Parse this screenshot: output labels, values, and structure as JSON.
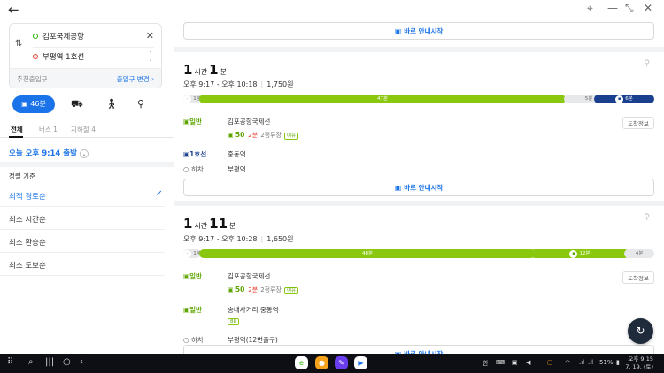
{
  "origin": "김포국제공항",
  "destination": "부평역 1호선",
  "entrance_recommend": "추천출입구",
  "entrance_change": "출입구 변경",
  "modes": {
    "transit_time": "46분"
  },
  "tabs": [
    "전체",
    "버스 1",
    "지하철 4"
  ],
  "departure": "오늘 오후 9:14 출발",
  "sort": {
    "title": "정렬 기준",
    "options": [
      "최적 경로순",
      "최소 시간순",
      "최소 환승순",
      "최소 도보순"
    ],
    "selected": 0
  },
  "nav_label": "바로 안내시작",
  "routes": [
    {
      "dur_h": "1",
      "dur_h_unit": "시간",
      "dur_m": "1",
      "dur_m_unit": "분",
      "time_range": "오후 9:17 - 오후 10:18",
      "fare": "1,750원",
      "segments": [
        {
          "type": "grey",
          "label": "1분"
        },
        {
          "type": "green",
          "label": "47분",
          "fraction": 0.77
        },
        {
          "type": "grey",
          "label": "5분"
        },
        {
          "type": "navy",
          "label": "6분"
        }
      ],
      "legs": [
        {
          "mode": "일반",
          "kind": "bus",
          "stop": "김포공항국제선",
          "badge": "도착정보",
          "bus_no": "50",
          "wait": "2분",
          "stops_left": "2정류장",
          "tag": "여유"
        },
        {
          "mode": "1호선",
          "kind": "subway",
          "stop": "중동역"
        },
        {
          "mode": "하차",
          "kind": "alight",
          "stop": "부평역"
        }
      ]
    },
    {
      "dur_h": "1",
      "dur_h_unit": "시간",
      "dur_m": "11",
      "dur_m_unit": "분",
      "time_range": "오후 9:17 - 오후 10:28",
      "fare": "1,650원",
      "segments": [
        {
          "type": "grey",
          "label": "1분"
        },
        {
          "type": "green",
          "label": "48분",
          "fraction": 0.68
        },
        {
          "type": "green",
          "label": "12분",
          "fraction": 0.17
        },
        {
          "type": "grey",
          "label": "4분"
        }
      ],
      "legs": [
        {
          "mode": "일반",
          "kind": "bus",
          "stop": "김포공항국제선",
          "badge": "도착정보",
          "bus_no": "50",
          "wait": "2분",
          "stops_left": "2정류장",
          "tag": "여유"
        },
        {
          "mode": "일반",
          "kind": "bus",
          "stop": "송내사거리.중동역",
          "tag": "88"
        },
        {
          "mode": "하차",
          "kind": "alight",
          "stop": "부평역(12번출구)"
        }
      ]
    }
  ],
  "taskbar": {
    "lang": "한",
    "battery": "51%",
    "time": "오후 9:15",
    "date": "7. 19. (토)"
  }
}
